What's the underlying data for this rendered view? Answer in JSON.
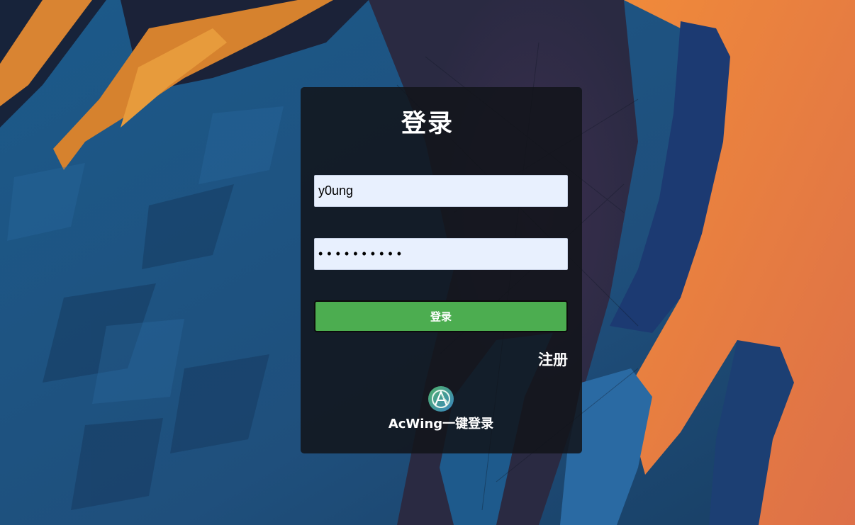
{
  "login": {
    "title": "登录",
    "username_value": "y0ung",
    "password_value": "••••••••••",
    "submit_label": "登录",
    "register_label": "注册",
    "acwing_label": "AcWing一键登录"
  },
  "icons": {
    "acwing_logo": "acwing-logo-icon"
  },
  "colors": {
    "button_green": "#4cad50",
    "input_background": "#e8f0fe",
    "card_background": "#12141a",
    "background_blue": "#1e4f7e",
    "background_orange": "#e07a40"
  }
}
